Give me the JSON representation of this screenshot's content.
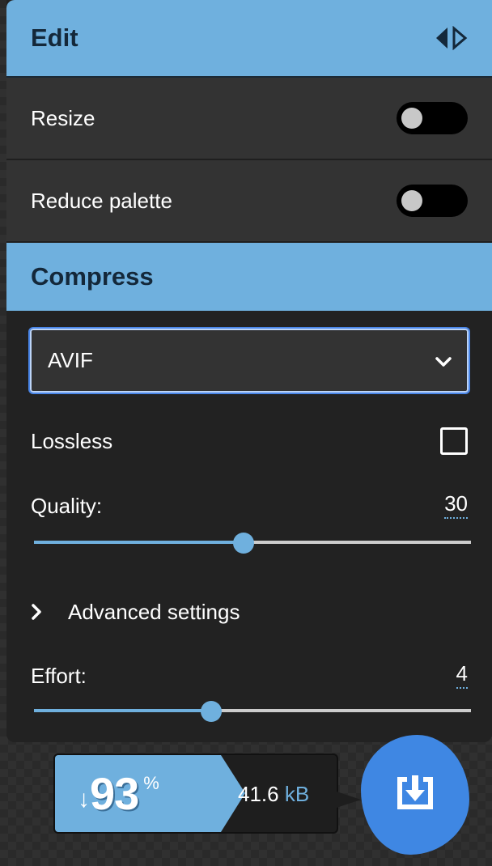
{
  "edit": {
    "title": "Edit",
    "rows": [
      {
        "label": "Resize",
        "enabled": false
      },
      {
        "label": "Reduce palette",
        "enabled": false
      }
    ]
  },
  "compress": {
    "title": "Compress",
    "format": "AVIF",
    "lossless_label": "Lossless",
    "lossless_checked": false,
    "quality_label": "Quality:",
    "quality_value": "30",
    "quality_fraction": 0.48,
    "advanced_label": "Advanced settings",
    "effort_label": "Effort:",
    "effort_value": "4",
    "effort_fraction": 0.405
  },
  "results": {
    "percent": "93",
    "percent_sign": "%",
    "size_value": "41.6",
    "size_unit": "kB"
  },
  "icons": {
    "panel_toggle": "left-right-triangles-icon",
    "select_arrow": "chevron-down-icon",
    "advanced_arrow": "chevron-right-icon",
    "download": "download-icon",
    "reduction": "down-arrow-icon"
  },
  "colors": {
    "accent": "#6fb0de",
    "download": "#3f87e3",
    "header_text": "#14283a"
  }
}
